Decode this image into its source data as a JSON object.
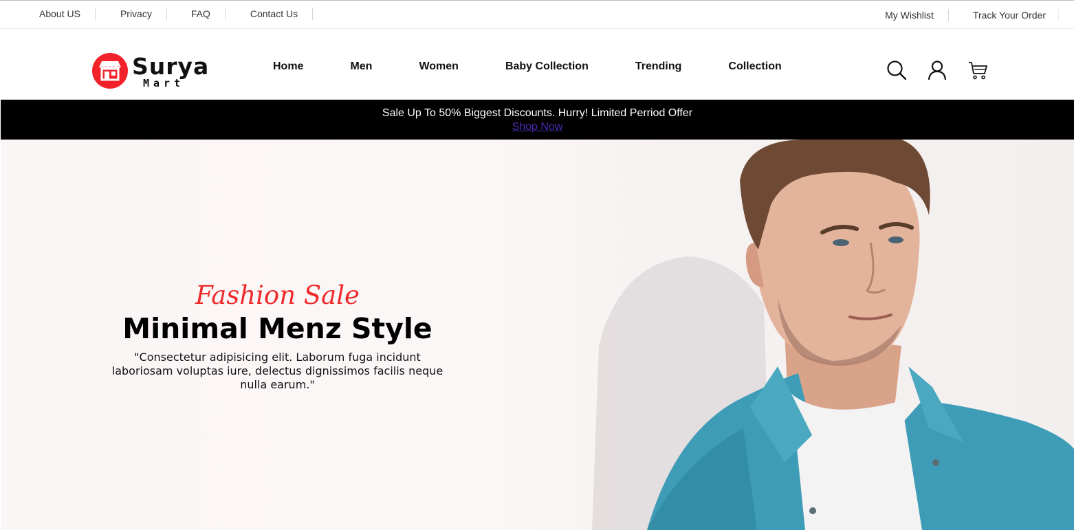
{
  "topbar": {
    "left_links": [
      "About US",
      "Privacy",
      "FAQ",
      "Contact Us"
    ],
    "wishlist": "My Wishlist",
    "track_order": "Track Your Order"
  },
  "header": {
    "logo_word": "Surya",
    "logo_sub": "Mart",
    "nav": [
      "Home",
      "Men",
      "Women",
      "Baby Collection",
      "Trending",
      "Collection"
    ],
    "icons": [
      "search-icon",
      "user-icon",
      "cart-icon"
    ]
  },
  "promo": {
    "message": "Sale Up To 50% Biggest Discounts. Hurry! Limited Perriod Offer",
    "cta": "Shop Now"
  },
  "hero": {
    "kicker": "Fashion Sale",
    "headline": "Minimal Menz Style",
    "blurb": "\"Consectetur adipisicing elit. Laborum fuga incidunt laboriosam voluptas iure, delectus dignissimos facilis neque nulla earum.\""
  },
  "colors": {
    "brand_red": "#f2222b",
    "promo_bg": "#000000",
    "link_purple": "#4b2ab1",
    "shirt_denim": "#3f9cb6"
  }
}
